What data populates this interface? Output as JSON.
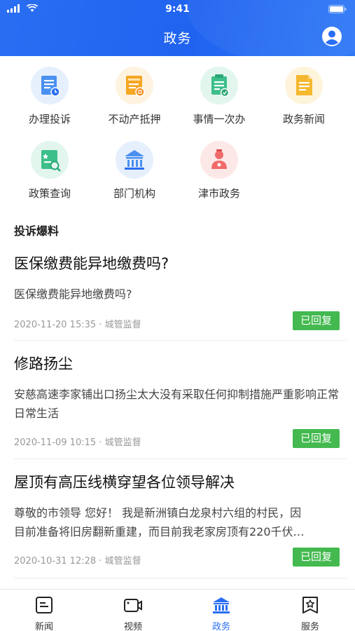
{
  "status_bar": {
    "time": "9:41"
  },
  "header": {
    "title": "政务"
  },
  "grid": [
    {
      "label": "办理投诉",
      "icon": "complaint-icon",
      "color": "#4a90f0"
    },
    {
      "label": "不动产抵押",
      "icon": "property-icon",
      "color": "#f5a623"
    },
    {
      "label": "事情一次办",
      "icon": "clipboard-icon",
      "color": "#3dbf8a"
    },
    {
      "label": "政务新闻",
      "icon": "news-icon",
      "color": "#f5b82e"
    },
    {
      "label": "政策查询",
      "icon": "policy-search-icon",
      "color": "#3dbf8a"
    },
    {
      "label": "部门机构",
      "icon": "government-building-icon",
      "color": "#4a90f0"
    },
    {
      "label": "津市政务",
      "icon": "official-icon",
      "color": "#f06a6a"
    }
  ],
  "section": {
    "title": "投诉爆料"
  },
  "news": [
    {
      "title": "医保缴费能异地缴费吗?",
      "body": " 医保缴费能异地缴费吗?",
      "date": "2020-11-20 15:35",
      "category": "城管监督",
      "status": "已回复"
    },
    {
      "title": "修路扬尘",
      "body": "安慈高速李家铺出口扬尘太大没有采取任何抑制措施严重影响正常日常生活",
      "date": "2020-11-09 10:15",
      "category": "城管监督",
      "status": "已回复"
    },
    {
      "title": "屋顶有高压线横穿望各位领导解决",
      "body_line1": "尊敬的市领导 您好！ 我是新洲镇白龙泉村六组的村民，因",
      "body_line2": "目前准备将旧房翻新重建，而目前我老家房顶有220千伏…",
      "date": "2020-10-31 12:28",
      "category": "城管监督",
      "status": "已回复"
    }
  ],
  "meta_separator": " · ",
  "tabbar": [
    {
      "label": "新闻",
      "icon": "news-tab-icon"
    },
    {
      "label": "视频",
      "icon": "video-tab-icon"
    },
    {
      "label": "政务",
      "icon": "government-tab-icon",
      "active": true
    },
    {
      "label": "服务",
      "icon": "service-tab-icon"
    }
  ],
  "colors": {
    "primary": "#2a6ef3",
    "badge_green": "#43b94f"
  }
}
